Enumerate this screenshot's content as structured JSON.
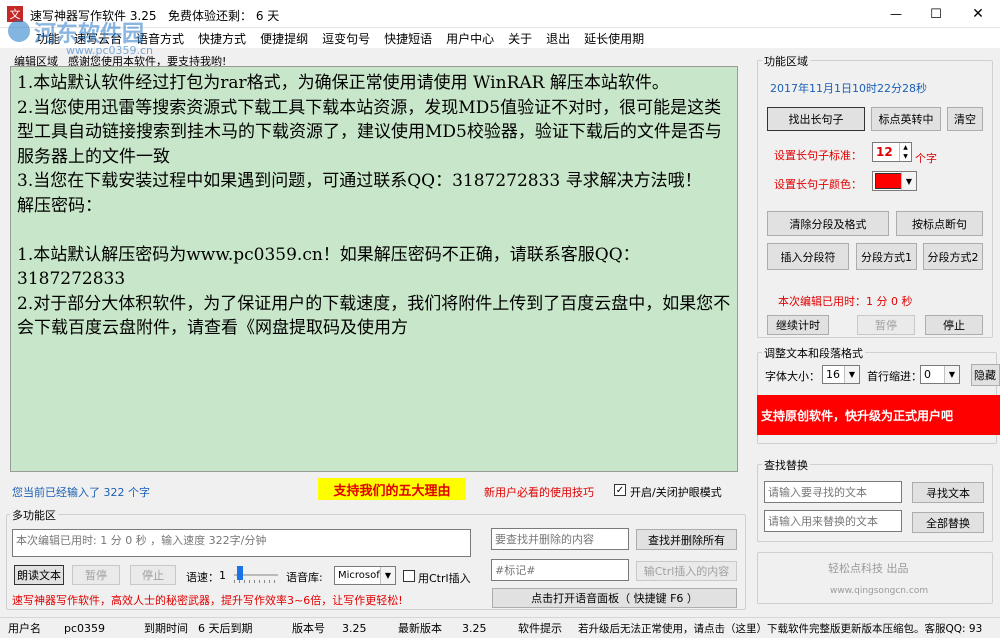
{
  "window": {
    "title": "速写神器写作软件 3.25",
    "trial_text": "免费体验还剩：  6 天",
    "minimize": "—",
    "maximize": "☐",
    "close": "✕"
  },
  "watermark": {
    "line1": "河东软件园",
    "line2": "www.pc0359.cn"
  },
  "menu": [
    "功能",
    "速写云台",
    "语音方式",
    "快捷方式",
    "便捷提纲",
    "逗变句号",
    "快捷短语",
    "用户中心",
    "关于",
    "退出",
    "延长使用期"
  ],
  "editor": {
    "group_label": "编辑区域",
    "banner": "感谢您使用本软件，要支持我哟!",
    "lines": [
      "1.本站默认软件经过打包为rar格式，为确保正常使用请使用 WinRAR 解压本站软件。",
      "2.当您使用迅雷等搜索资源式下载工具下载本站资源，发现MD5值验证不对时，很可能是这类型工具自动链接搜索到挂木马的下载资源了，建议使用MD5校验器，验证下载后的文件是否与服务器上的文件一致",
      "3.当您在下载安装过程中如果遇到问题，可通过联系QQ：3187272833 寻求解决方法哦！",
      "解压密码：",
      "",
      "1.本站默认解压密码为www.pc0359.cn！如果解压密码不正确，请联系客服QQ：3187272833",
      "2.对于部分大体积软件，为了保证用户的下载速度，我们将附件上传到了百度云盘中，如果您不会下载百度云盘附件，请查看《网盘提取码及使用方"
    ]
  },
  "below_editor": {
    "count_text": "您当前已经输入了 322 个字",
    "reasons_label": "支持我们的五大理由",
    "tips_link": "新用户必看的使用技巧",
    "eye_checkbox_label": "开启/关闭护眼模式",
    "eye_checked": true
  },
  "multi": {
    "group_label": "多功能区",
    "time_speed": "本次编辑已用时: 1 分 0 秒 ，输入速度 322字/分钟",
    "find_delete_placeholder": "要查找并删除的内容",
    "find_delete_button": "查找并删除所有",
    "read_button": "朗读文本",
    "pause_button": "暂停",
    "stop_button": "停止",
    "speed_label": "语速：",
    "speed_value": "1",
    "voice_label": "语音库:",
    "voice_value": "Microsof",
    "ctrl_checkbox_label": "用Ctrl插入",
    "ctrl_checked": false,
    "marker_value": "#标记#",
    "ctrl_insert_button": "输Ctrl插入的内容",
    "slogan": "速写神器写作软件，高效人士的秘密武器，提升写作效率3~6倍，让写作更轻松!",
    "voice_panel_button": "点击打开语音面板（ 快捷键 F6 ）"
  },
  "func": {
    "group_label": "功能区域",
    "datetime": "2017年11月1日10时22分28秒",
    "find_long": "找出长句子",
    "punct_convert": "标点英转中",
    "clear": "清空",
    "long_std_label": "设置长句子标准：",
    "long_std_value": "12",
    "long_std_unit": "个字",
    "long_color_label": "设置长句子颜色：",
    "long_color": "#ff0000",
    "clear_format": "清除分段及格式",
    "punct_break": "按标点断句",
    "insert_para": "插入分段符",
    "para_mode1": "分段方式1",
    "para_mode2": "分段方式2",
    "edit_time": "本次编辑已用时：1 分 0 秒",
    "continue": "继续计时",
    "pause": "暂停",
    "stop": "停止"
  },
  "format": {
    "group_label": "调整文本和段落格式",
    "font_size_label": "字体大小：",
    "font_size_value": "16",
    "indent_label": "首行缩进：",
    "indent_value": "0",
    "hide_button": "隐藏",
    "promo": "支持原创软件，快升级为正式用户吧"
  },
  "findreplace": {
    "group_label": "查找替换",
    "find_placeholder": "请输入要寻找的文本",
    "find_button": "寻找文本",
    "replace_placeholder": "请输入用来替换的文本",
    "replace_button": "全部替换"
  },
  "brand": {
    "name": "轻松点科技  出品",
    "url": "www.qingsongcn.com"
  },
  "status": {
    "user_label": "用户名",
    "user_value": "pc0359",
    "expiry_label": "到期时间",
    "expiry_value": "6 天后到期",
    "version_label": "版本号",
    "version_value": "3.25",
    "latest_label": "最新版本",
    "latest_value": "3.25",
    "tip_label": "软件提示",
    "tip_value": "若升级后无法正常使用，请点击（这里）下载软件完整版更新版本压缩包。客服QQ: 93"
  },
  "colors": {
    "editor_bg": "#c8e6c9",
    "promo_bg": "#ff0000",
    "accent_blue": "#1a5fb4",
    "red_text": "#e00000"
  }
}
